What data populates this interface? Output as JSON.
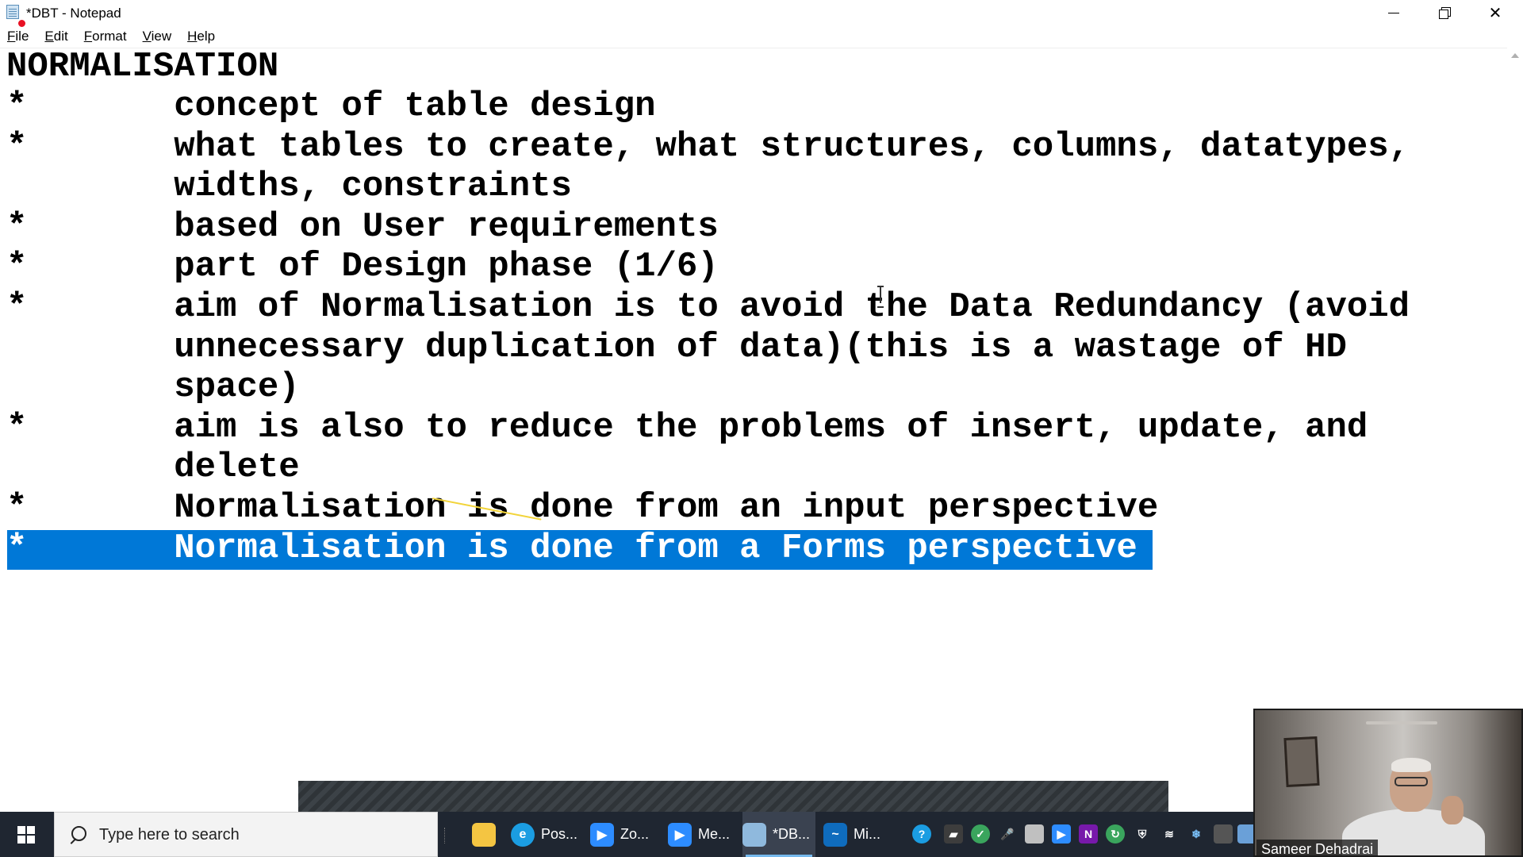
{
  "window": {
    "title": "*DBT - Notepad",
    "menu": [
      {
        "accel": "F",
        "rest": "ile"
      },
      {
        "accel": "E",
        "rest": "dit"
      },
      {
        "accel": "F",
        "rest": "ormat"
      },
      {
        "accel": "V",
        "rest": "iew"
      },
      {
        "accel": "H",
        "rest": "elp"
      }
    ]
  },
  "document": {
    "lines": [
      "NORMALISATION",
      "*       concept of table design",
      "*       what tables to create, what structures, columns, datatypes,",
      "        widths, constraints",
      "*       based on User requirements",
      "*       part of Design phase (1/6)",
      "*       aim of Normalisation is to avoid the Data Redundancy (avoid",
      "        unnecessary duplication of data)(this is a wastage of HD",
      "        space)",
      "*       aim is also to reduce the problems of insert, update, and",
      "        delete",
      "*       Normalisation is done from an input perspective",
      "*       Normalisation is done from a Forms perspective"
    ],
    "selected_line_index": 12
  },
  "taskbar": {
    "search_placeholder": "Type here to search",
    "apps": [
      {
        "label": "",
        "icon": "file-explorer-icon",
        "color": "#f4c542"
      },
      {
        "label": "Pos...",
        "icon": "edge-icon",
        "color": "#1b9de2"
      },
      {
        "label": "Zo...",
        "icon": "zoom-icon",
        "color": "#2d8cff"
      },
      {
        "label": "Me...",
        "icon": "zoom-meeting-icon",
        "color": "#2d8cff"
      },
      {
        "label": "*DB...",
        "icon": "notepad-icon",
        "color": "#8fb9dd"
      },
      {
        "label": "Mi...",
        "icon": "whiteboard-icon",
        "color": "#0f6cbd"
      }
    ]
  },
  "webcam": {
    "participant_name": "Sameer Dehadrai"
  },
  "colors": {
    "selection": "#0078d7",
    "taskbar": "#1f2631"
  }
}
